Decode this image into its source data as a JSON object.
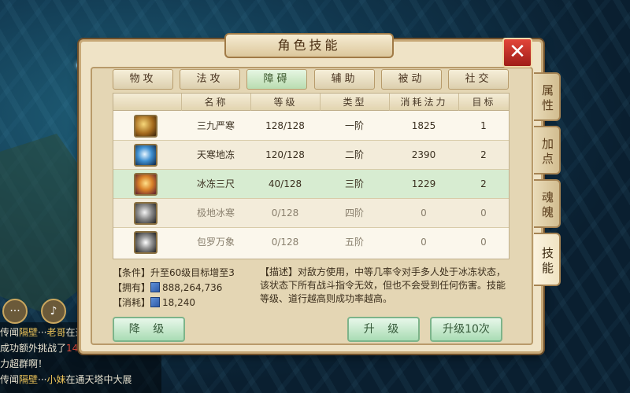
{
  "window": {
    "title": "角色技能",
    "close_label": "✕"
  },
  "tabs": [
    {
      "label": "物攻",
      "active": false
    },
    {
      "label": "法攻",
      "active": false
    },
    {
      "label": "障碍",
      "active": true
    },
    {
      "label": "辅助",
      "active": false
    },
    {
      "label": "被动",
      "active": false
    },
    {
      "label": "社交",
      "active": false
    }
  ],
  "side_tabs": [
    {
      "label": "属性",
      "active": false
    },
    {
      "label": "加点",
      "active": false
    },
    {
      "label": "魂魄",
      "active": false
    },
    {
      "label": "技能",
      "active": true
    }
  ],
  "table": {
    "headers": [
      "名称",
      "等级",
      "类型",
      "消耗法力",
      "目标"
    ],
    "rows": [
      {
        "name": "三九严寒",
        "level": "128/128",
        "type": "一阶",
        "mana": "1825",
        "target": "1",
        "icon": "bronze-spiral-icon",
        "state": "normal"
      },
      {
        "name": "天寒地冻",
        "level": "120/128",
        "type": "二阶",
        "mana": "2390",
        "target": "2",
        "icon": "blue-vortex-icon",
        "state": "alt"
      },
      {
        "name": "冰冻三尺",
        "level": "40/128",
        "type": "三阶",
        "mana": "1229",
        "target": "2",
        "icon": "golden-crest-icon",
        "state": "selected"
      },
      {
        "name": "极地冰寒",
        "level": "0/128",
        "type": "四阶",
        "mana": "0",
        "target": "0",
        "icon": "grey-crystal-icon",
        "state": "locked"
      },
      {
        "name": "包罗万象",
        "level": "0/128",
        "type": "五阶",
        "mana": "0",
        "target": "0",
        "icon": "grey-shatter-icon",
        "state": "locked"
      }
    ]
  },
  "info": {
    "condition_tag": "【条件】",
    "condition_text": "升至60级目标增至3",
    "owned_tag": "【拥有】",
    "owned_value": "888,264,736",
    "cost_tag": "【消耗】",
    "cost_value": "18,240"
  },
  "description": {
    "tag": "【描述】",
    "text": "对敌方使用，中等几率令对手多人处于冰冻状态，该状态下所有战斗指令无效，但也不会受到任何伤害。技能等级、道行越高则成功率越高。"
  },
  "buttons": {
    "downgrade": "降 级",
    "upgrade": "升 级",
    "upgrade10": "升级10次"
  },
  "chat": {
    "line1_prefix": "传闻",
    "line1_name": "隔壁",
    "line1_name2": "老哥",
    "line1_text": "在通",
    "line2": "成功额外挑战了",
    "line2_num": "14",
    "line3": "力超群啊！",
    "line4_prefix": "传闻",
    "line4_name": "隔壁",
    "line4_name2": "小妹",
    "line4_text": "在通天塔中大展"
  },
  "colors": {
    "accent_green": "#a9dcb4",
    "close_red": "#c62a22",
    "panel": "#efe3c6"
  }
}
